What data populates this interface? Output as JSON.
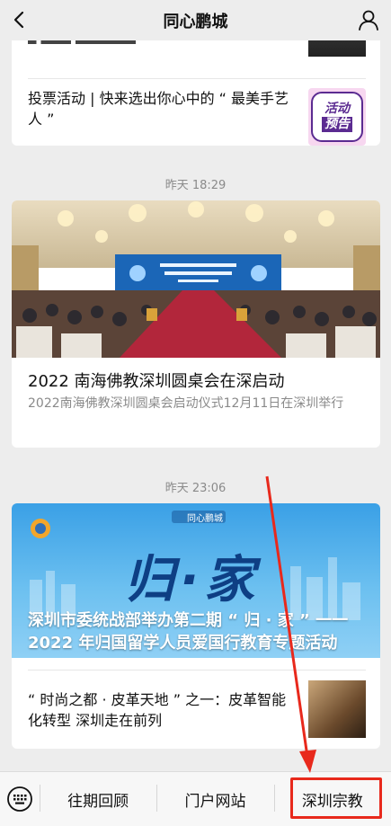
{
  "header": {
    "title": "同心鹏城"
  },
  "card1": {
    "item2_text": "投票活动 | 快来选出你心中的 “ 最美手艺人 ”",
    "badge_line1": "活动",
    "badge_line2": "预告"
  },
  "timestamps": [
    "昨天 18:29",
    "昨天 23:06"
  ],
  "card2": {
    "headline": "2022 南海佛教深圳圆桌会在深启动",
    "summary": "2022南海佛教深圳圆桌会启动仪式12月11日在深圳举行"
  },
  "card3": {
    "banner_brand": "同心鹏城",
    "banner_calligraphy": "归·家",
    "banner_caption": "深圳市委统战部举办第二期 “ 归 · 家 ” 一一 2022 年归国留学人员爱国行教育专题活动",
    "sub_text": "“ 时尚之都 · 皮革天地 ” 之一：皮革智能化转型 深圳走在前列"
  },
  "bottom_menu": {
    "items": [
      "往期回顾",
      "门户网站",
      "深圳宗教"
    ]
  },
  "colors": {
    "accent_annotation": "#e8291c"
  },
  "icons": [
    "back-arrow-icon",
    "user-icon",
    "keyboard-icon"
  ]
}
